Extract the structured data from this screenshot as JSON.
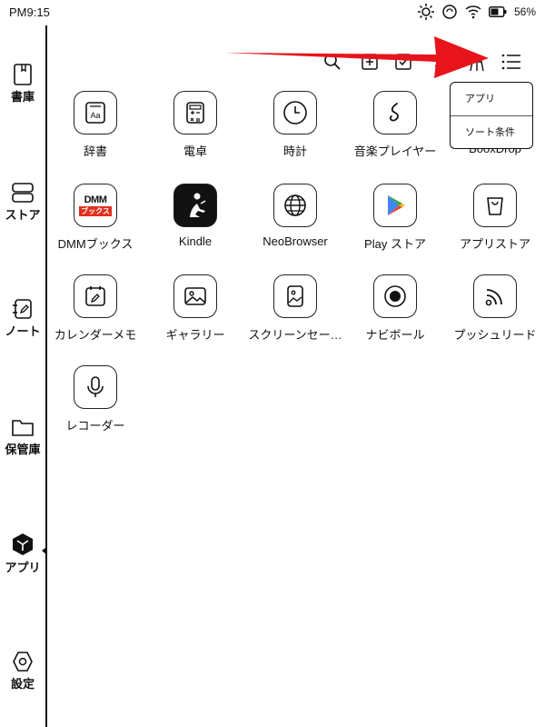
{
  "status": {
    "time": "PM9:15",
    "battery": "56%"
  },
  "sidebar": {
    "items": [
      {
        "label": "書庫",
        "icon": "book-icon"
      },
      {
        "label": "ストア",
        "icon": "store-icon"
      },
      {
        "label": "ノート",
        "icon": "note-icon"
      },
      {
        "label": "保管庫",
        "icon": "folder-icon"
      },
      {
        "label": "アプリ",
        "icon": "apps-icon",
        "active": true
      },
      {
        "label": "設定",
        "icon": "settings-icon"
      }
    ]
  },
  "toolbar": {
    "icons": [
      "search-icon",
      "add-icon",
      "checklist-icon",
      "sync-icon",
      "clean-icon",
      "menu-icon"
    ]
  },
  "popup": {
    "items": [
      "アプリ",
      "ソート条件"
    ]
  },
  "apps": [
    {
      "name": "辞書",
      "icon": "dictionary-icon"
    },
    {
      "name": "電卓",
      "icon": "calculator-icon"
    },
    {
      "name": "時計",
      "icon": "clock-icon"
    },
    {
      "name": "音楽プレイヤー",
      "icon": "music-icon"
    },
    {
      "name": "BooxDrop",
      "icon": "booxdrop-icon"
    },
    {
      "name": "DMMブックス",
      "icon": "dmm-books-icon",
      "badge_top": "DMM",
      "badge_bottom": "ブックス"
    },
    {
      "name": "Kindle",
      "icon": "kindle-icon"
    },
    {
      "name": "NeoBrowser",
      "icon": "globe-icon"
    },
    {
      "name": "Play ストア",
      "icon": "play-store-icon"
    },
    {
      "name": "アプリストア",
      "icon": "bag-icon"
    },
    {
      "name": "カレンダーメモ",
      "icon": "calendar-memo-icon"
    },
    {
      "name": "ギャラリー",
      "icon": "gallery-icon"
    },
    {
      "name": "スクリーンセー…",
      "icon": "screensaver-icon"
    },
    {
      "name": "ナビボール",
      "icon": "navball-icon"
    },
    {
      "name": "プッシュリード",
      "icon": "rss-icon"
    },
    {
      "name": "レコーダー",
      "icon": "microphone-icon"
    }
  ],
  "colors": {
    "arrow": "#e8141b",
    "dmm_red": "#e0301e",
    "play_green": "#32a350",
    "play_blue": "#4285f4",
    "play_yellow": "#fbbc04",
    "play_red": "#ea4335"
  }
}
